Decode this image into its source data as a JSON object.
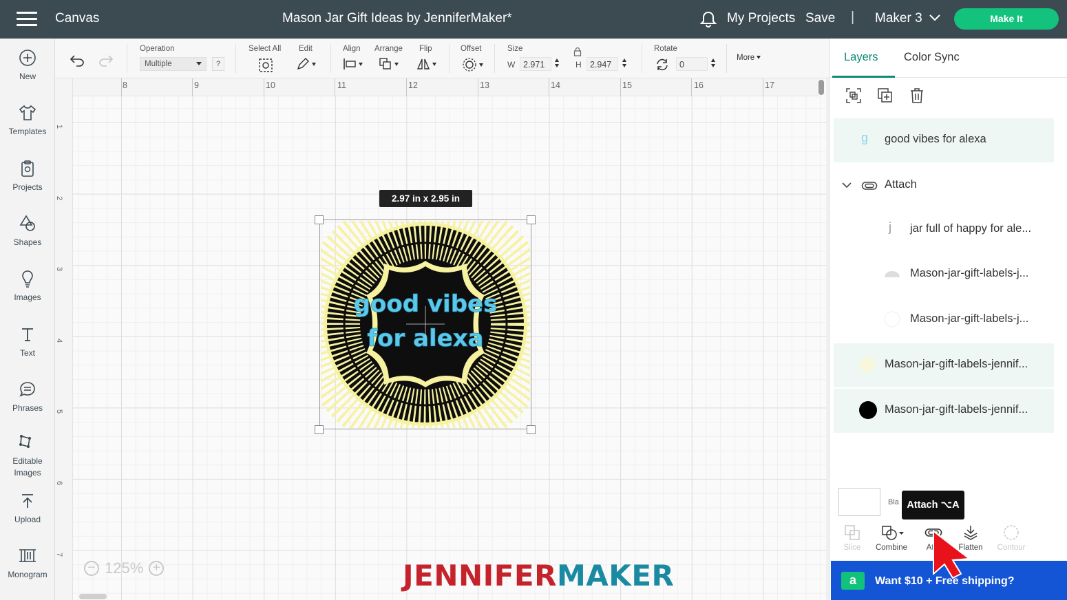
{
  "topbar": {
    "app_title": "Canvas",
    "doc_title": "Mason Jar Gift Ideas by JenniferMaker*",
    "my_projects": "My Projects",
    "save": "Save",
    "separator": "|",
    "machine": "Maker 3",
    "make_it": "Make It"
  },
  "sidebar": {
    "items": [
      {
        "label": "New",
        "icon": "plus-circle-icon"
      },
      {
        "label": "Templates",
        "icon": "shirt-icon"
      },
      {
        "label": "Projects",
        "icon": "clipboard-icon"
      },
      {
        "label": "Shapes",
        "icon": "shapes-icon"
      },
      {
        "label": "Images",
        "icon": "bulb-icon"
      },
      {
        "label": "Text",
        "icon": "text-icon"
      },
      {
        "label": "Phrases",
        "icon": "speech-bubble-icon"
      },
      {
        "label": "Editable Images",
        "icon": "editable-image-icon"
      },
      {
        "label": "Upload",
        "icon": "upload-icon"
      },
      {
        "label": "Monogram",
        "icon": "monogram-icon"
      }
    ]
  },
  "toolbar": {
    "operation_label": "Operation",
    "operation_value": "Multiple",
    "help": "?",
    "select_all": "Select All",
    "edit": "Edit",
    "align": "Align",
    "arrange": "Arrange",
    "flip": "Flip",
    "offset": "Offset",
    "size": "Size",
    "w_label": "W",
    "w_value": "2.971",
    "h_label": "H",
    "h_value": "2.947",
    "rotate": "Rotate",
    "rotate_value": "0",
    "more": "More"
  },
  "canvas": {
    "ruler_top": [
      "8",
      "9",
      "10",
      "11",
      "12",
      "13",
      "14",
      "15",
      "16",
      "17"
    ],
    "ruler_left": [
      "1",
      "2",
      "3",
      "4",
      "5",
      "6",
      "7"
    ],
    "size_tooltip": "2.97  in x 2.95  in",
    "zoom_minus": "−",
    "zoom_value": "125%",
    "zoom_plus": "+",
    "design_text_1": "good vibes",
    "design_text_2": "for alexa",
    "brand_1": "JENNIFER",
    "brand_2": "MAKER"
  },
  "panel": {
    "tab_layers": "Layers",
    "tab_color_sync": "Color Sync",
    "layers": [
      {
        "name": "good vibes for alexa",
        "thumb": "g",
        "highlight": true
      },
      {
        "name": "Attach",
        "group": true
      },
      {
        "name": "jar full of happy for ale...",
        "thumb": "j"
      },
      {
        "name": "Mason-jar-gift-labels-j..."
      },
      {
        "name": "Mason-jar-gift-labels-j..."
      },
      {
        "name": "Mason-jar-gift-labels-jennif...",
        "highlight": true
      },
      {
        "name": "Mason-jar-gift-labels-jennif...",
        "highlight": true,
        "swatch": "#000000"
      }
    ],
    "blank_label": "Bla",
    "tooltip": "Attach ⌥A",
    "actions": {
      "slice": "Slice",
      "combine": "Combine",
      "attach": "Atta",
      "flatten": "Flatten",
      "contour": "Contour"
    },
    "promo": "Want $10 + Free shipping?",
    "promo_icon": "a"
  },
  "colors": {
    "accent": "#13c27d",
    "topbar": "#3c4a52",
    "tab_active": "#0e8a78",
    "promo": "#1455d6"
  }
}
